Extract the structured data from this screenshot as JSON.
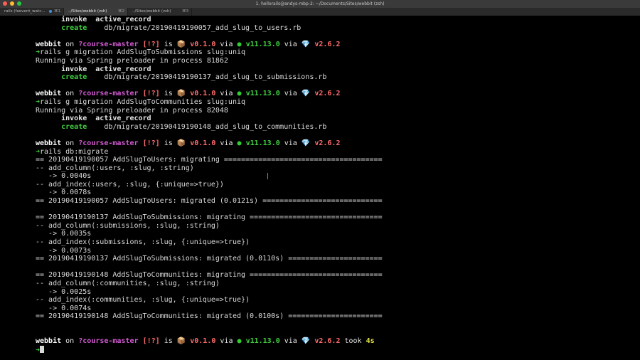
{
  "window": {
    "title": "1. hellorails@andys-mbp-2: ~/Documents/Sites/webbit (zsh)"
  },
  "tabs": [
    {
      "label": "rails (faevent_watc...",
      "shortcut": "⌘1",
      "active": false,
      "has_dot": true
    },
    {
      "label": "../Sites/webbit (zsh)",
      "shortcut": "⌘2",
      "active": true,
      "has_dot": false
    },
    {
      "label": "../Sites/webbit (zsh)",
      "shortcut": "⌘3",
      "active": false,
      "has_dot": false
    }
  ],
  "prompt": {
    "dir": "webbit",
    "on": "on",
    "branch": "?course-master",
    "status": "[!?]",
    "is": "is",
    "pkg_icon": "package-icon",
    "pkg_version": "v0.1.0",
    "via": "via",
    "node_icon": "node-icon",
    "node_version": "v11.13.0",
    "ruby_icon": "ruby-gem-icon",
    "ruby_version": "v2.6.2",
    "arrow": "➜"
  },
  "lines": {
    "l1_invoke": "      invoke  active_record",
    "l2_create_kw": "      create",
    "l2_create_path": "    db/migrate/20190419190057_add_slug_to_users.rb",
    "cmd1": "rails g migration AddSlugToSubmissions slug:uniq",
    "spring1": "Running via Spring preloader in process 81862",
    "invoke2": "      invoke  active_record",
    "create2_path": "    db/migrate/20190419190137_add_slug_to_submissions.rb",
    "cmd2": "rails g migration AddSlugToCommunities slug:uniq",
    "spring2": "Running via Spring preloader in process 82048",
    "invoke3": "      invoke  active_record",
    "create3_path": "    db/migrate/20190419190148_add_slug_to_communities.rb",
    "cmd3": "rails db:migrate",
    "m1": "== 20190419190057 AddSlugToUsers: migrating =====================================",
    "m2": "-- add_column(:users, :slug, :string)",
    "m3": "   -> 0.0040s",
    "m4": "-- add_index(:users, :slug, {:unique=>true})",
    "m5": "   -> 0.0078s",
    "m6": "== 20190419190057 AddSlugToUsers: migrated (0.0121s) ============================",
    "n1": "== 20190419190137 AddSlugToSubmissions: migrating ===============================",
    "n2": "-- add_column(:submissions, :slug, :string)",
    "n3": "   -> 0.0035s",
    "n4": "-- add_index(:submissions, :slug, {:unique=>true})",
    "n5": "   -> 0.0073s",
    "n6": "== 20190419190137 AddSlugToSubmissions: migrated (0.0110s) ======================",
    "o1": "== 20190419190148 AddSlugToCommunities: migrating ===============================",
    "o2": "-- add_column(:communities, :slug, :string)",
    "o3": "   -> 0.0025s",
    "o4": "-- add_index(:communities, :slug, {:unique=>true})",
    "o5": "   -> 0.0074s",
    "o6": "== 20190419190148 AddSlugToCommunities: migrated (0.0100s) ======================",
    "took": "took",
    "took_time": "4s"
  }
}
